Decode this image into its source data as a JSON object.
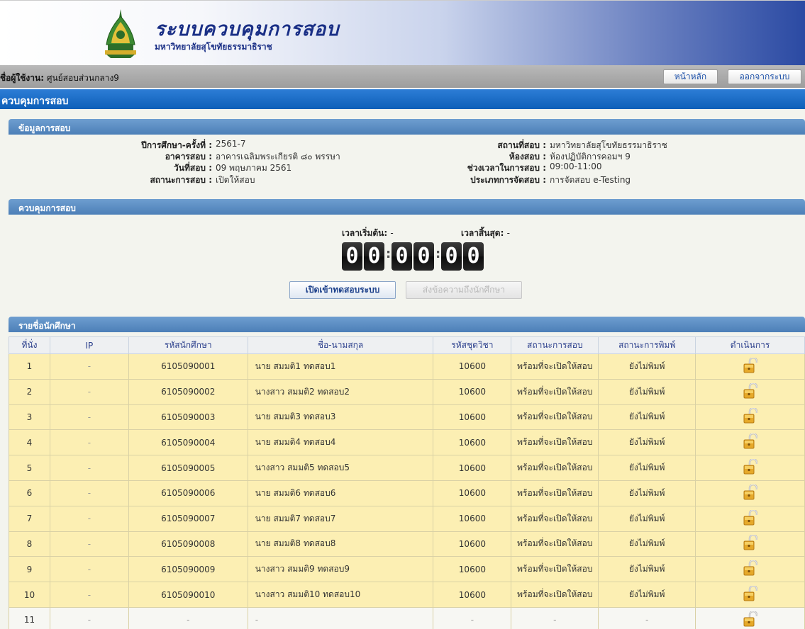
{
  "header": {
    "title": "ระบบควบคุมการสอบ",
    "subtitle": "มหาวิทยาลัยสุโขทัยธรรมาธิราช"
  },
  "userbar": {
    "user_label": "ชื่อผู้ใช้งาน:",
    "user_name": "ศูนย์สอบส่วนกลาง9",
    "home_button": "หน้าหลัก",
    "logout_button": "ออกจากระบบ"
  },
  "page_title": "ควบคุมการสอบ",
  "exam_info": {
    "section_title": "ข้อมูลการสอบ",
    "left": [
      {
        "label": "ปีการศึกษา-ครั้งที่ :",
        "value": "2561-7"
      },
      {
        "label": "อาคารสอบ :",
        "value": "อาคารเฉลิมพระเกียรติ ๘๐ พรรษา"
      },
      {
        "label": "วันที่สอบ :",
        "value": "09 พฤษภาคม 2561"
      },
      {
        "label": "สถานะการสอบ :",
        "value": "เปิดให้สอบ"
      }
    ],
    "right": [
      {
        "label": "สถานที่สอบ :",
        "value": "มหาวิทยาลัยสุโขทัยธรรมาธิราช"
      },
      {
        "label": "ห้องสอบ :",
        "value": "ห้องปฏิบัติการคอมฯ 9"
      },
      {
        "label": "ช่วงเวลาในการสอบ :",
        "value": "09:00-11:00"
      },
      {
        "label": "ประเภทการจัดสอบ :",
        "value": "การจัดสอบ e-Testing"
      }
    ]
  },
  "control": {
    "section_title": "ควบคุมการสอบ",
    "start_label": "เวลาเริ่มต้น:",
    "start_value": "-",
    "end_label": "เวลาสิ้นสุด:",
    "end_value": "-",
    "timer": [
      "0",
      "0",
      "0",
      "0",
      "0",
      "0"
    ],
    "open_button": "เปิดเข้าทดสอบระบบ",
    "message_button": "ส่งข้อความถึงนักศึกษา"
  },
  "students": {
    "section_title": "รายชื่อนักศึกษา",
    "columns": [
      "ที่นั่ง",
      "IP",
      "รหัสนักศึกษา",
      "ชื่อ-นามสกุล",
      "รหัสชุดวิชา",
      "สถานะการสอบ",
      "สถานะการพิมพ์",
      "ดำเนินการ"
    ],
    "rows": [
      {
        "seat": "1",
        "ip": "-",
        "id": "6105090001",
        "name": "นาย สมมติ1 ทดสอบ1",
        "course": "10600",
        "exam_status": "พร้อมที่จะเปิดให้สอบ",
        "print_status": "ยังไม่พิมพ์",
        "action_icon": "unlock-icon"
      },
      {
        "seat": "2",
        "ip": "-",
        "id": "6105090002",
        "name": "นางสาว สมมติ2 ทดสอบ2",
        "course": "10600",
        "exam_status": "พร้อมที่จะเปิดให้สอบ",
        "print_status": "ยังไม่พิมพ์",
        "action_icon": "unlock-icon"
      },
      {
        "seat": "3",
        "ip": "-",
        "id": "6105090003",
        "name": "นาย สมมติ3 ทดสอบ3",
        "course": "10600",
        "exam_status": "พร้อมที่จะเปิดให้สอบ",
        "print_status": "ยังไม่พิมพ์",
        "action_icon": "unlock-icon"
      },
      {
        "seat": "4",
        "ip": "-",
        "id": "6105090004",
        "name": "นาย สมมติ4 ทดสอบ4",
        "course": "10600",
        "exam_status": "พร้อมที่จะเปิดให้สอบ",
        "print_status": "ยังไม่พิมพ์",
        "action_icon": "unlock-icon"
      },
      {
        "seat": "5",
        "ip": "-",
        "id": "6105090005",
        "name": "นางสาว สมมติ5 ทดสอบ5",
        "course": "10600",
        "exam_status": "พร้อมที่จะเปิดให้สอบ",
        "print_status": "ยังไม่พิมพ์",
        "action_icon": "unlock-icon"
      },
      {
        "seat": "6",
        "ip": "-",
        "id": "6105090006",
        "name": "นาย สมมติ6 ทดสอบ6",
        "course": "10600",
        "exam_status": "พร้อมที่จะเปิดให้สอบ",
        "print_status": "ยังไม่พิมพ์",
        "action_icon": "unlock-icon"
      },
      {
        "seat": "7",
        "ip": "-",
        "id": "6105090007",
        "name": "นาย สมมติ7 ทดสอบ7",
        "course": "10600",
        "exam_status": "พร้อมที่จะเปิดให้สอบ",
        "print_status": "ยังไม่พิมพ์",
        "action_icon": "unlock-icon"
      },
      {
        "seat": "8",
        "ip": "-",
        "id": "6105090008",
        "name": "นาย สมมติ8 ทดสอบ8",
        "course": "10600",
        "exam_status": "พร้อมที่จะเปิดให้สอบ",
        "print_status": "ยังไม่พิมพ์",
        "action_icon": "unlock-icon"
      },
      {
        "seat": "9",
        "ip": "-",
        "id": "6105090009",
        "name": "นางสาว สมมติ9 ทดสอบ9",
        "course": "10600",
        "exam_status": "พร้อมที่จะเปิดให้สอบ",
        "print_status": "ยังไม่พิมพ์",
        "action_icon": "unlock-icon"
      },
      {
        "seat": "10",
        "ip": "-",
        "id": "6105090010",
        "name": "นางสาว สมมติ10 ทดสอบ10",
        "course": "10600",
        "exam_status": "พร้อมที่จะเปิดให้สอบ",
        "print_status": "ยังไม่พิมพ์",
        "action_icon": "unlock-icon"
      },
      {
        "seat": "11",
        "ip": "-",
        "id": "-",
        "name": "-",
        "course": "-",
        "exam_status": "-",
        "print_status": "-",
        "action_icon": "unlock-icon"
      }
    ]
  },
  "colors": {
    "header_blue": "#0d5fb8",
    "section_blue": "#4c7fb7",
    "row_yellow": "#fcefb3"
  }
}
